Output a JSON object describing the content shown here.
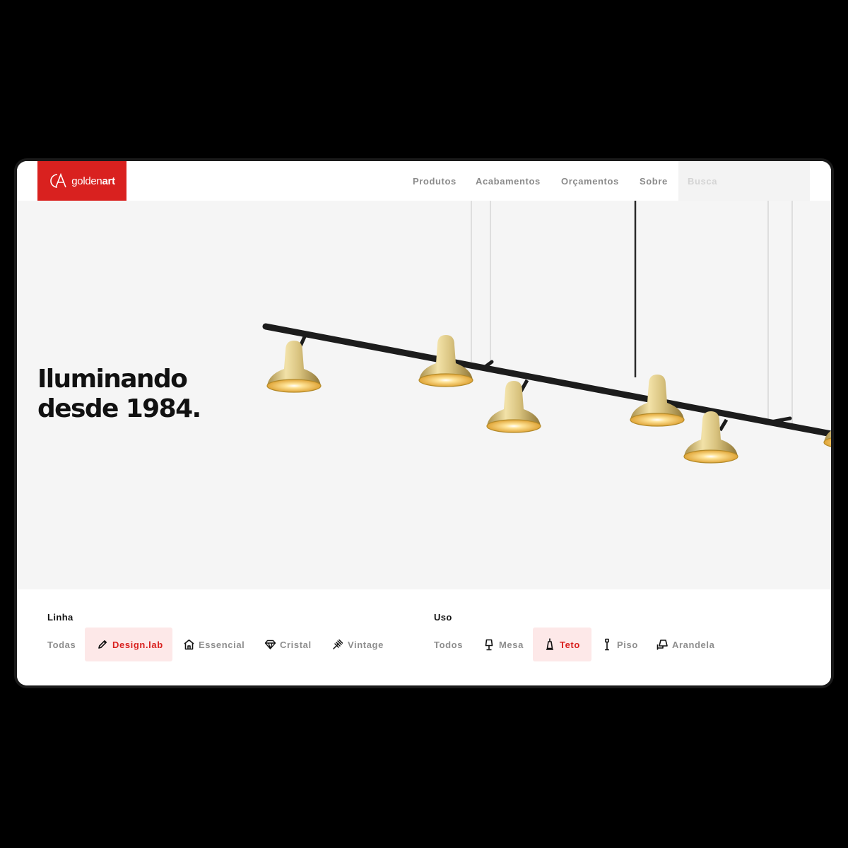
{
  "header": {
    "logo": {
      "light": "golden",
      "bold": "art"
    },
    "nav": [
      "Produtos",
      "Acabamentos",
      "Orçamentos",
      "Sobre"
    ],
    "search_placeholder": "Busca"
  },
  "hero": {
    "headline_line1": "Iluminando",
    "headline_line2": "desde 1984."
  },
  "filters": {
    "linha": {
      "label": "Linha",
      "options": [
        {
          "label": "Todas",
          "icon": null
        },
        {
          "label": "Design.lab",
          "icon": "pencil-icon",
          "selected": true
        },
        {
          "label": "Essencial",
          "icon": "house-icon"
        },
        {
          "label": "Cristal",
          "icon": "diamond-icon"
        },
        {
          "label": "Vintage",
          "icon": "ornament-icon"
        }
      ]
    },
    "uso": {
      "label": "Uso",
      "options": [
        {
          "label": "Todos",
          "icon": null
        },
        {
          "label": "Mesa",
          "icon": "table-lamp-icon"
        },
        {
          "label": "Teto",
          "icon": "pendant-lamp-icon",
          "selected": true
        },
        {
          "label": "Piso",
          "icon": "floor-lamp-icon"
        },
        {
          "label": "Arandela",
          "icon": "wall-lamp-icon"
        }
      ]
    }
  },
  "colors": {
    "brand_red": "#d9211f",
    "selected_bg": "#fde8e8",
    "hero_bg": "#f5f5f5",
    "brass": "#cdb46a",
    "bulb_glow": "#e0a21a"
  }
}
